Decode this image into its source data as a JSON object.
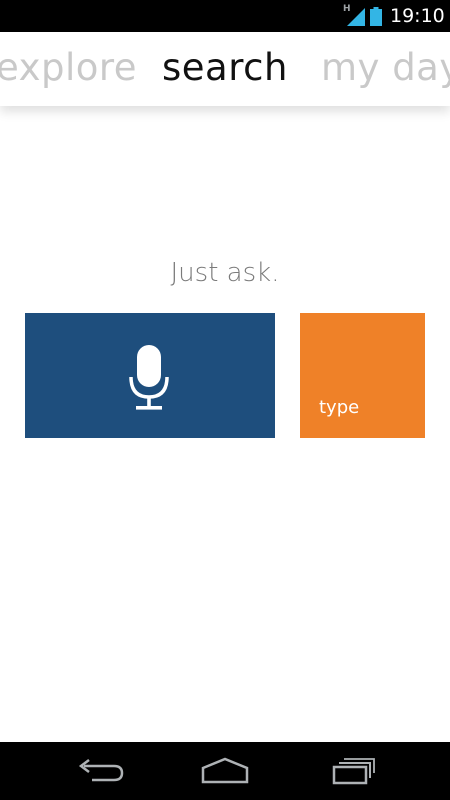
{
  "status_bar": {
    "network_type": "H",
    "time": "19:10",
    "icons": [
      "signal-icon",
      "battery-icon"
    ]
  },
  "tabs": [
    {
      "label": "explore",
      "active": false
    },
    {
      "label": "search",
      "active": true
    },
    {
      "label": "my day",
      "active": false
    }
  ],
  "main": {
    "prompt": "Just ask.",
    "voice_button": {
      "icon": "microphone-icon",
      "color": "#1e4e7d"
    },
    "type_button": {
      "label": "type",
      "color": "#ef8128"
    }
  },
  "nav_bar": {
    "buttons": [
      "back-icon",
      "home-icon",
      "recent-apps-icon"
    ]
  }
}
